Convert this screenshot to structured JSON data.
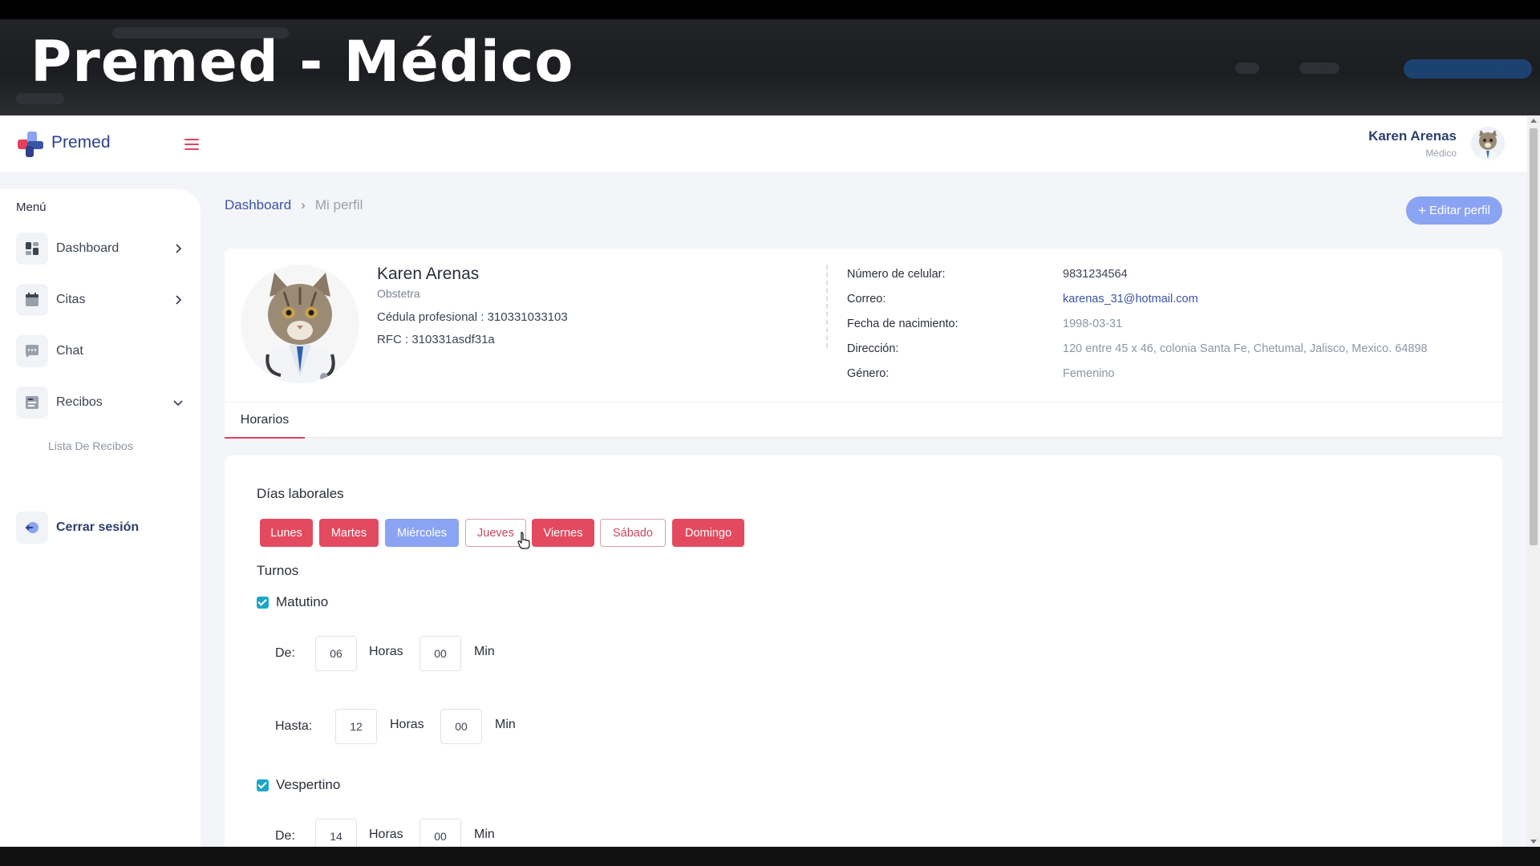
{
  "video_title": "Premed - Médico",
  "header": {
    "brand": "Premed",
    "user_name": "Karen Arenas",
    "user_role": "Médico"
  },
  "sidebar": {
    "menu_title": "Menú",
    "items": [
      {
        "label": "Dashboard",
        "icon": "dashboard-icon"
      },
      {
        "label": "Citas",
        "icon": "calendar-icon"
      },
      {
        "label": "Chat",
        "icon": "chat-icon"
      },
      {
        "label": "Recibos",
        "icon": "receipt-icon"
      }
    ],
    "sub_items": [
      "Lista De Recibos"
    ],
    "logout": "Cerrar sesión"
  },
  "breadcrumb": {
    "root": "Dashboard",
    "current": "Mi perfil"
  },
  "edit_button": "Editar perfil",
  "profile": {
    "name": "Karen Arenas",
    "specialty": "Obstetra",
    "cedula": "Cédula profesional : 310331033103",
    "rfc": "RFC : 310331asdf31a"
  },
  "details": [
    {
      "label": "Número de celular:",
      "value": "9831234564"
    },
    {
      "label": "Correo:",
      "value": "karenas_31@hotmail.com"
    },
    {
      "label": "Fecha de nacimiento:",
      "value": "1998-03-31"
    },
    {
      "label": "Dirección:",
      "value": "120 entre 45 x 46, colonia Santa Fe, Chetumal, Jalisco, Mexico. 64898"
    },
    {
      "label": "Género:",
      "value": "Femenino"
    }
  ],
  "tabs": [
    "Horarios"
  ],
  "schedule": {
    "work_days_title": "Días laborales",
    "days": [
      {
        "label": "Lunes",
        "state": "active"
      },
      {
        "label": "Martes",
        "state": "active"
      },
      {
        "label": "Miércoles",
        "state": "selected"
      },
      {
        "label": "Jueves",
        "state": "inactive"
      },
      {
        "label": "Viernes",
        "state": "active"
      },
      {
        "label": "Sábado",
        "state": "inactive"
      },
      {
        "label": "Domingo",
        "state": "active"
      }
    ],
    "shifts_title": "Turnos",
    "shifts": [
      {
        "label": "Matutino",
        "checked": true,
        "from_label": "De:",
        "from_hours": "06",
        "from_minutes": "00",
        "to_label": "Hasta:",
        "to_hours": "12",
        "to_minutes": "00"
      },
      {
        "label": "Vespertino",
        "checked": true,
        "from_label": "De:",
        "from_hours": "14",
        "from_minutes": "00"
      }
    ],
    "hours_unit": "Horas",
    "minutes_unit": "Min"
  },
  "colors": {
    "accent_red": "#e34a60",
    "accent_blue": "#8aa3f2",
    "brand_navy": "#2d3f8f",
    "check_teal": "#1aa6c8"
  }
}
